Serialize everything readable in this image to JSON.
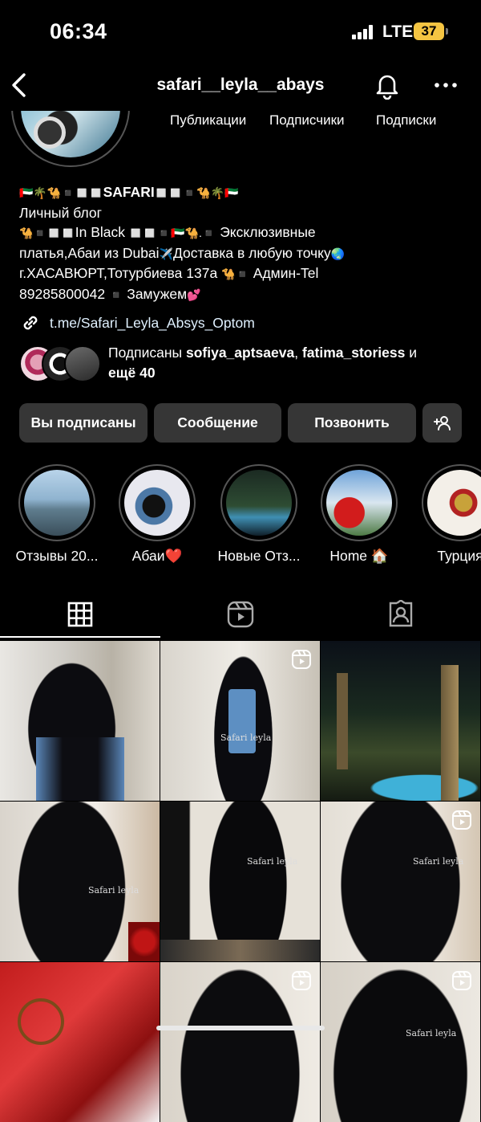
{
  "status_bar": {
    "time": "06:34",
    "network": "LTE",
    "battery": "37"
  },
  "header": {
    "username": "safari__leyla__abays"
  },
  "stats": {
    "posts_label": "Публикации",
    "followers_label": "Подписчики",
    "following_label": "Подписки"
  },
  "bio": {
    "line1": "SAFARI",
    "line2": "Личный блог",
    "line3a": "In Black",
    "line3b": "Эксклюзивные",
    "line4": "платья,Абаи из Dubai",
    "line4b": "Доставка в любую точку",
    "line5": "г.ХАСАВЮРТ,Тотурбиева 137а",
    "line5b": "Админ-Tel",
    "line6": "89285800042",
    "line6b": "Замужем"
  },
  "link": {
    "text": "t.me/Safari_Leyla_Absys_Optom"
  },
  "followed_by": {
    "prefix": "Подписаны ",
    "user1": "sofiya_aptsaeva",
    "sep": ", ",
    "user2": "fatima_storiess",
    "suffix": " и",
    "line2": "ещё 40"
  },
  "buttons": {
    "following": "Вы подписаны",
    "message": "Сообщение",
    "call": "Позвонить"
  },
  "highlights": [
    {
      "label": "Отзывы 20..."
    },
    {
      "label": "Абаи❤️"
    },
    {
      "label": "Новые Отз..."
    },
    {
      "label": "Home 🏠"
    },
    {
      "label": "Турция"
    }
  ],
  "watermarks": {
    "w1": "Safari leyla",
    "w2": "Safari leyla",
    "w3": "Safari leyla",
    "w4": "Safari leyla",
    "w5": "Safari leyla"
  },
  "icons": [
    "back-arrow-icon",
    "bell-icon",
    "more-icon",
    "link-icon",
    "add-person-icon",
    "grid-icon",
    "reels-icon",
    "tagged-icon",
    "reel-icon"
  ]
}
